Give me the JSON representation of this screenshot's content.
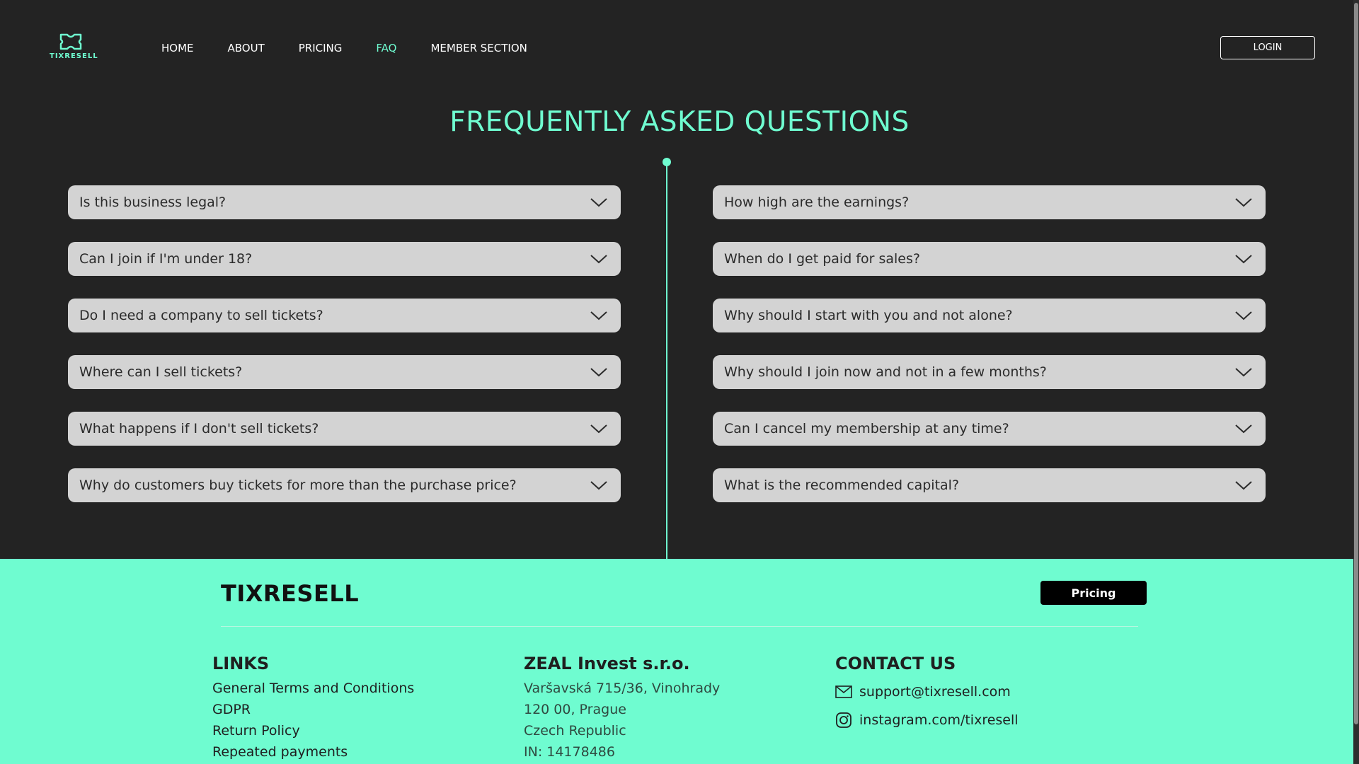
{
  "header": {
    "logo_text": "TIXRESELL",
    "nav": [
      "HOME",
      "ABOUT",
      "PRICING",
      "FAQ",
      "MEMBER SECTION"
    ],
    "active_nav": "FAQ",
    "login_label": "LOGIN"
  },
  "faq": {
    "title": "FREQUENTLY ASKED QUESTIONS",
    "left": [
      "Is this business legal?",
      "Can I join if I'm under 18?",
      "Do I need a company to sell tickets?",
      "Where can I sell tickets?",
      "What happens if I don't sell tickets?",
      "Why do customers buy tickets for more than the purchase price?"
    ],
    "right": [
      "How high are the earnings?",
      "When do I get paid for sales?",
      "Why should I start with you and not alone?",
      "Why should I join now and not in a few months?",
      "Can I cancel my membership at any time?",
      "What is the recommended capital?"
    ]
  },
  "footer": {
    "brand": "TIXRESELL",
    "pricing_label": "Pricing",
    "links_heading": "LINKS",
    "links": [
      "General Terms and Conditions",
      "GDPR",
      "Return Policy",
      "Repeated payments"
    ],
    "company_heading": "ZEAL Invest s.r.o.",
    "company_lines": [
      "Varšavská 715/36, Vinohrady",
      "120 00, Prague",
      "Czech Republic",
      "IN: 14178486"
    ],
    "contact_heading": "CONTACT US",
    "email": "support@tixresell.com",
    "instagram": "instagram.com/tixresell"
  },
  "colors": {
    "accent": "#6ffcd0",
    "background": "#232323",
    "card": "#d3d3d3"
  }
}
